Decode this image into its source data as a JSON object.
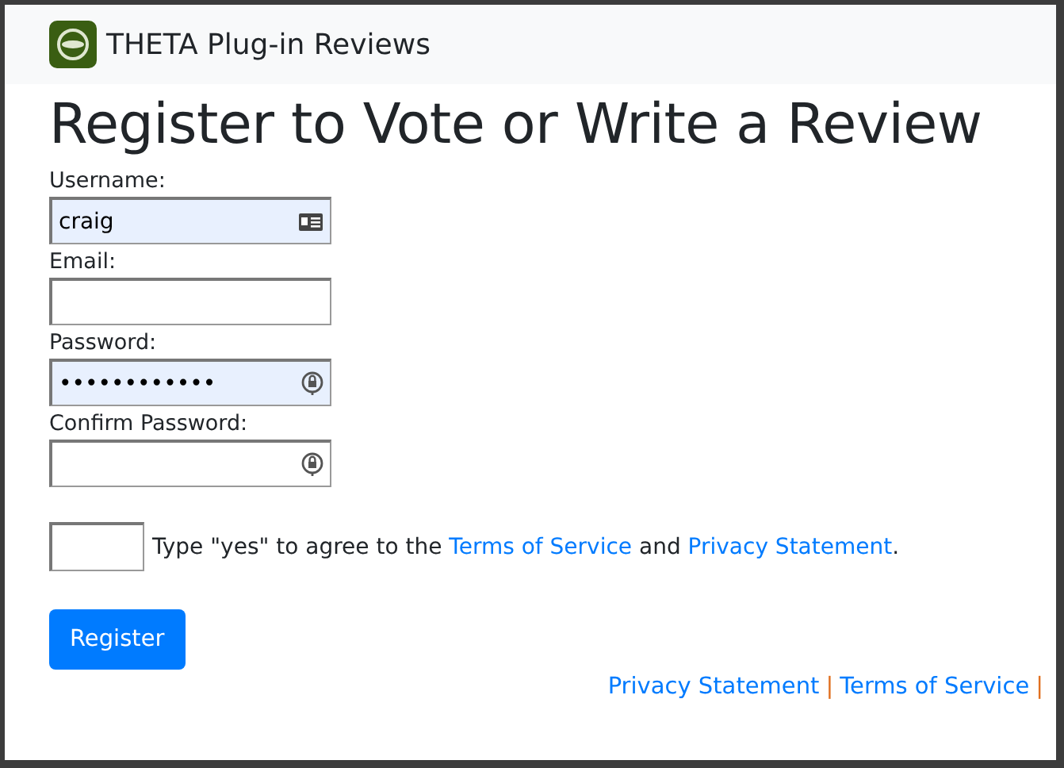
{
  "navbar": {
    "brand": "THETA Plug-in Reviews"
  },
  "heading": "Register to Vote or Write a Review",
  "fields": [
    {
      "kind": "username",
      "label": "Username:",
      "value": "craig",
      "autofilled": true
    },
    {
      "kind": "email",
      "label": "Email:",
      "autofilled": false
    },
    {
      "kind": "password",
      "label": "Password:",
      "value": "••••••••••••",
      "autofilled": true
    },
    {
      "kind": "password",
      "label": "Confirm Password:",
      "autofilled": false
    }
  ],
  "agree": {
    "before": "Type \"yes\" to agree to the",
    "link1": "Terms of Service",
    "middle": "and",
    "link2": "Privacy Statement",
    "after": "."
  },
  "button": "Register",
  "footer": [
    {
      "kind": "link",
      "text": "Privacy Statement"
    },
    {
      "kind": "sep",
      "text": "|"
    },
    {
      "kind": "link",
      "text": "Terms of Service"
    },
    {
      "kind": "sep",
      "text": "|"
    }
  ]
}
